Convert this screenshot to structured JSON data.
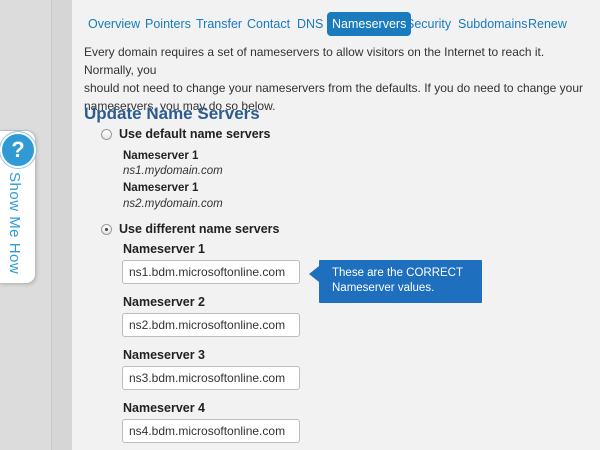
{
  "help_tab": {
    "icon": "question-icon",
    "symbol": "?",
    "label": "Show Me How"
  },
  "tabs": [
    {
      "label": "Overview"
    },
    {
      "label": "Pointers"
    },
    {
      "label": "Transfer"
    },
    {
      "label": "Contact"
    },
    {
      "label": "DNS"
    },
    {
      "label": "Nameservers",
      "active": true
    },
    {
      "label": "Security"
    },
    {
      "label": "Subdomains"
    },
    {
      "label": "Renew"
    }
  ],
  "intro": {
    "line1": "Every domain requires a set of nameservers to allow visitors on the Internet to reach it. Normally, you",
    "line2": "should not need to change your nameservers from the defaults. If you do need to change your",
    "line3": "nameservers, you may do so below."
  },
  "section_title": "Update Name Servers",
  "default_option": {
    "label": "Use default name servers",
    "selected": false,
    "servers": [
      {
        "label": "Nameserver 1",
        "value": "ns1.mydomain.com"
      },
      {
        "label": "Nameserver 1",
        "value": "ns2.mydomain.com"
      }
    ]
  },
  "custom_option": {
    "label": "Use different name servers",
    "selected": true,
    "fields": [
      {
        "label": "Nameserver 1",
        "value": "ns1.bdm.microsoftonline.com"
      },
      {
        "label": "Nameserver 2",
        "value": "ns2.bdm.microsoftonline.com"
      },
      {
        "label": "Nameserver 3",
        "value": "ns3.bdm.microsoftonline.com"
      },
      {
        "label": "Nameserver 4",
        "value": "ns4.bdm.microsoftonline.com"
      }
    ]
  },
  "callout": {
    "line1": "These are the CORRECT",
    "line2": "Nameserver values."
  },
  "colors": {
    "accent": "#1a7bbf",
    "heading": "#2d5d90",
    "callout": "#1f6fbf",
    "help": "#2f9ad4"
  }
}
